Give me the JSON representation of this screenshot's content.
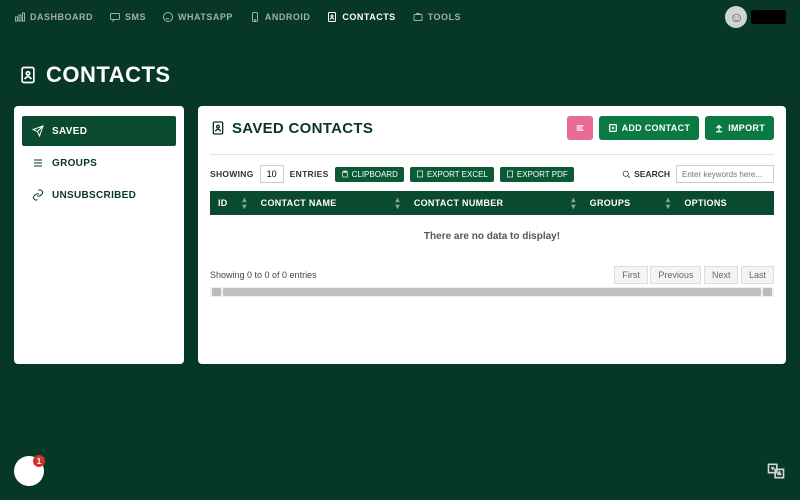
{
  "nav": {
    "dashboard": "DASHBOARD",
    "sms": "SMS",
    "whatsapp": "WHATSAPP",
    "android": "ANDROID",
    "contacts": "CONTACTS",
    "tools": "TOOLS"
  },
  "page_title": "CONTACTS",
  "sidebar": {
    "saved": "SAVED",
    "groups": "GROUPS",
    "unsubscribed": "UNSUBSCRIBED"
  },
  "panel": {
    "title": "SAVED CONTACTS",
    "add": "ADD CONTACT",
    "import": "IMPORT"
  },
  "toolbar": {
    "showing": "SHOWING",
    "count": "10",
    "entries": "ENTRIES",
    "clipboard": "CLIPBOARD",
    "excel": "EXPORT EXCEL",
    "pdf": "EXPORT PDF",
    "search": "SEARCH",
    "search_placeholder": "Enter keywords here..."
  },
  "columns": {
    "id": "ID",
    "name": "CONTACT NAME",
    "number": "CONTACT NUMBER",
    "groups": "GROUPS",
    "options": "OPTIONS"
  },
  "empty": "There are no data to display!",
  "footer": {
    "info": "Showing 0 to 0 of 0 entries",
    "first": "First",
    "previous": "Previous",
    "next": "Next",
    "last": "Last"
  },
  "chat": {
    "count": "1"
  }
}
